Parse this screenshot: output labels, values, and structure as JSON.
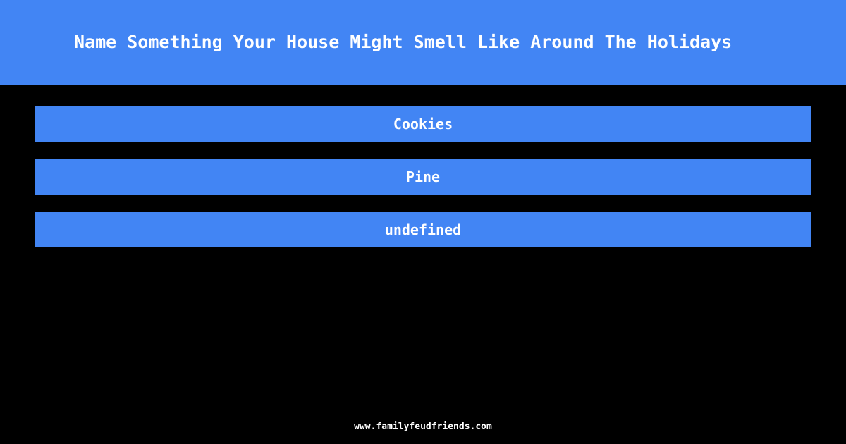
{
  "theme": {
    "background_color": "#000000",
    "accent_color": "#4285f4",
    "text_color": "#ffffff"
  },
  "header": {
    "title": "Name Something Your House Might Smell Like Around The Holidays"
  },
  "answers": {
    "items": [
      {
        "label": "Cookies"
      },
      {
        "label": "Pine"
      },
      {
        "label": "undefined"
      }
    ]
  },
  "footer": {
    "url": "www.familyfeudfriends.com"
  }
}
